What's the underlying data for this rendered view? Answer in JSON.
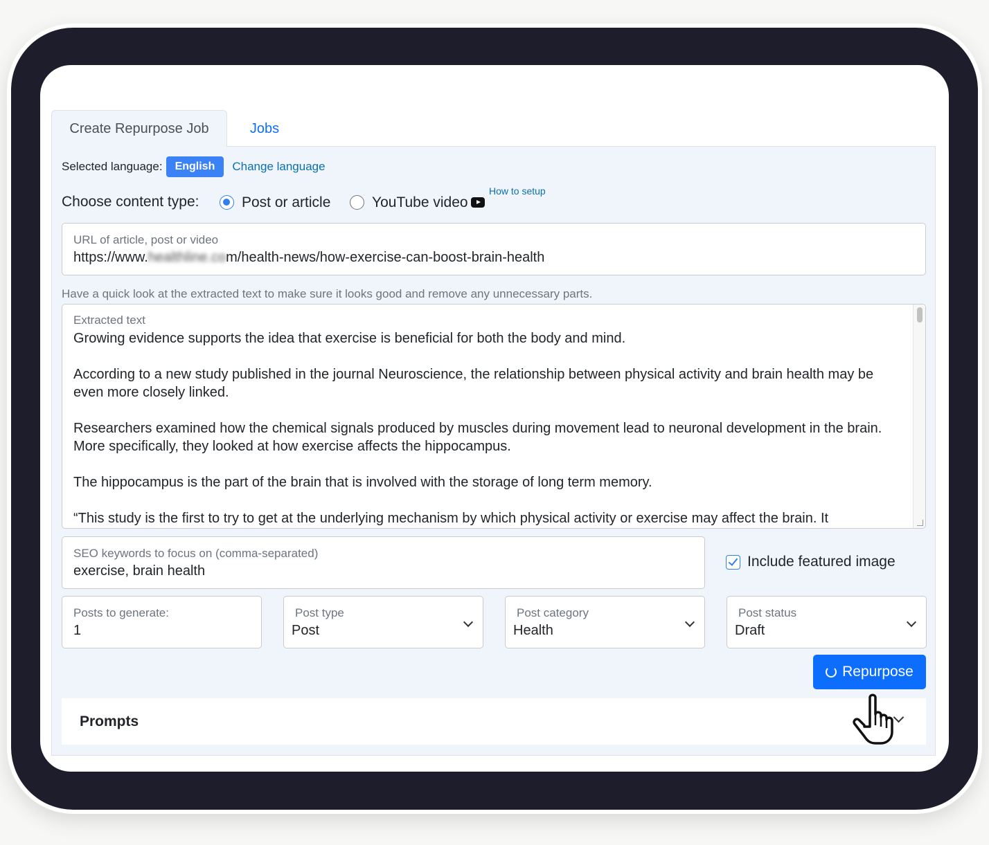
{
  "tabs": [
    {
      "label": "Create Repurpose Job",
      "active": true
    },
    {
      "label": "Jobs",
      "active": false
    }
  ],
  "language": {
    "label": "Selected language:",
    "value": "English",
    "change_link": "Change language"
  },
  "content_type": {
    "label": "Choose content type:",
    "options": [
      {
        "label": "Post or article",
        "selected": true
      },
      {
        "label": "YouTube video",
        "selected": false
      }
    ],
    "youtube_icon": "youtube-icon",
    "how_to_setup": "How to setup"
  },
  "url_field": {
    "label": "URL of article, post or video",
    "value_prefix": "https://www.",
    "value_blurred": "healthline.co",
    "value_suffix": "m/health-news/how-exercise-can-boost-brain-health"
  },
  "help_text": "Have a quick look at the extracted text to make sure it looks good and remove any unnecessary parts.",
  "extracted": {
    "label": "Extracted text",
    "paragraphs": [
      "Growing evidence supports the idea that exercise is beneficial for both the body and mind.",
      "According to a new study published in the journal Neuroscience, the relationship between physical activity and brain health may be even more closely linked.",
      "Researchers examined how the chemical signals produced by muscles during movement lead to neuronal development in the brain. More specifically, they looked at how exercise affects the hippocampus.",
      "The hippocampus is the part of the brain that is involved with the storage of long term memory.",
      "“This study is the first to try to get at the underlying mechanism by which physical activity or exercise may affect the brain. It"
    ]
  },
  "seo": {
    "label": "SEO keywords to focus on (comma-separated)",
    "value": "exercise, brain health"
  },
  "featured_image": {
    "label": "Include featured image",
    "checked": true
  },
  "posts_to_generate": {
    "label": "Posts to generate:",
    "value": "1"
  },
  "post_type": {
    "label": "Post type",
    "value": "Post"
  },
  "post_category": {
    "label": "Post category",
    "value": "Health"
  },
  "post_status": {
    "label": "Post status",
    "value": "Draft"
  },
  "repurpose_button": "Repurpose",
  "prompts": {
    "label": "Prompts"
  },
  "colors": {
    "accent": "#0d6efd",
    "badge": "#3b82f6",
    "panel_bg": "#f0f5fc",
    "device": "#1d1d2b"
  }
}
